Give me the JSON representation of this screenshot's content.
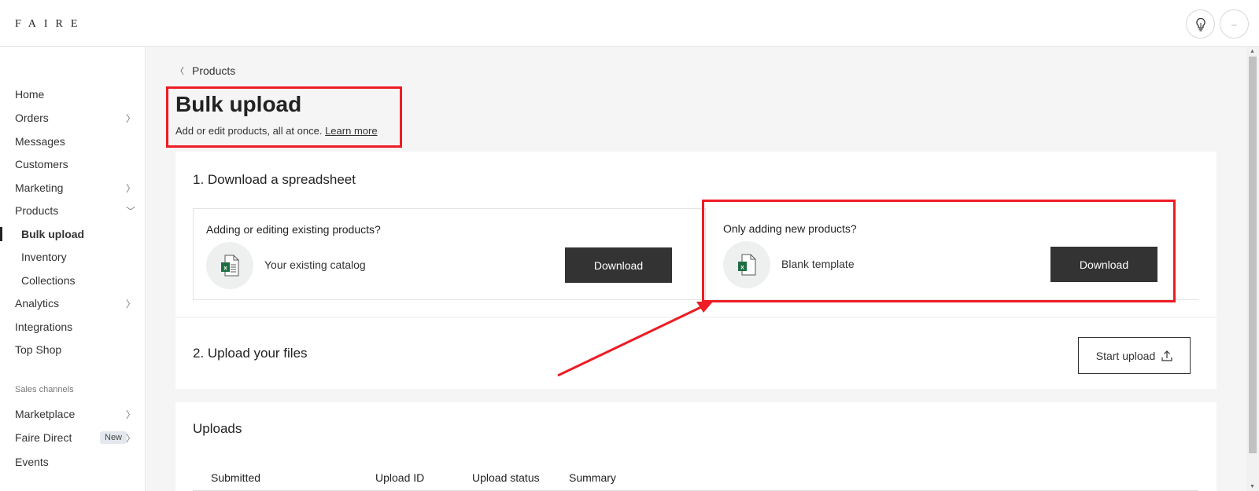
{
  "header": {
    "logo": "FAIRE"
  },
  "sidebar": {
    "items": [
      {
        "label": "Home"
      },
      {
        "label": "Orders"
      },
      {
        "label": "Messages"
      },
      {
        "label": "Customers"
      },
      {
        "label": "Marketing"
      },
      {
        "label": "Products"
      },
      {
        "label": "Bulk upload"
      },
      {
        "label": "Inventory"
      },
      {
        "label": "Collections"
      },
      {
        "label": "Analytics"
      },
      {
        "label": "Integrations"
      },
      {
        "label": "Top Shop"
      }
    ],
    "sales_channels_label": "Sales channels",
    "channels": [
      {
        "label": "Marketplace"
      },
      {
        "label": "Faire Direct",
        "badge": "New"
      },
      {
        "label": "Events"
      }
    ]
  },
  "main": {
    "breadcrumb": "Products",
    "title": "Bulk upload",
    "subtitle": "Add or edit products, all at once.",
    "learn_more": "Learn more",
    "step1": {
      "title": "1. Download a spreadsheet",
      "left": {
        "question": "Adding or editing existing products?",
        "name": "Your existing catalog",
        "button": "Download"
      },
      "right": {
        "question": "Only adding new products?",
        "name": "Blank template",
        "button": "Download"
      }
    },
    "step2": {
      "title": "2. Upload your files",
      "button": "Start upload"
    },
    "uploads": {
      "title": "Uploads",
      "columns": [
        "Submitted",
        "Upload ID",
        "Upload status",
        "Summary"
      ]
    }
  },
  "colors": {
    "annotation": "#ee1c24",
    "button_dark": "#333333",
    "page_bg": "#f5f5f5"
  }
}
